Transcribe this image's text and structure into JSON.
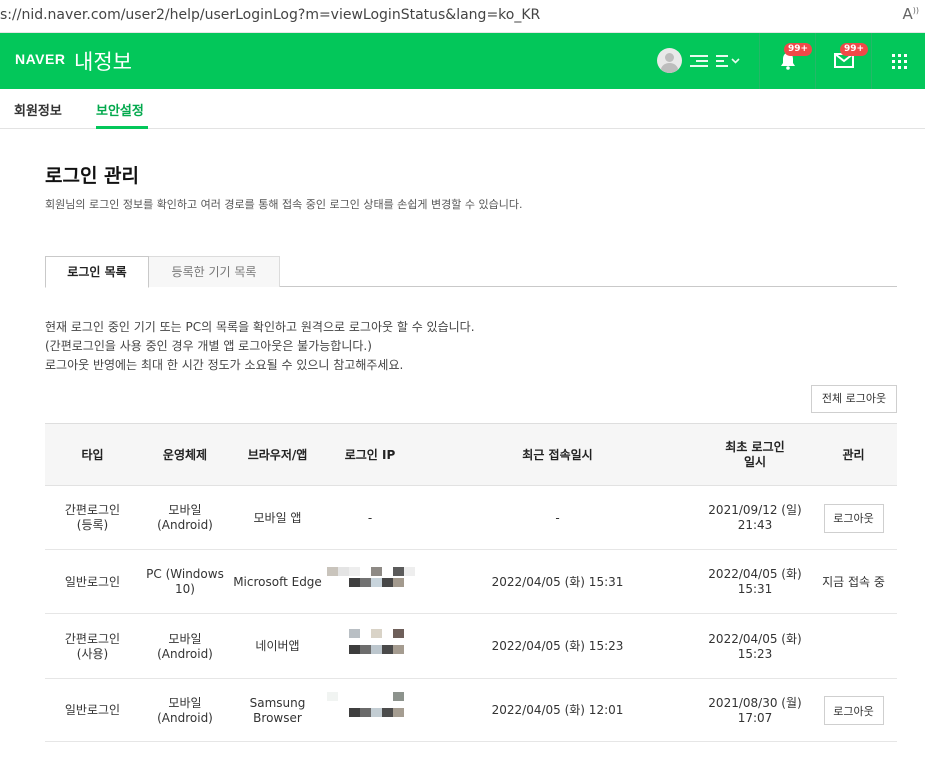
{
  "browser": {
    "url": "s://nid.naver.com/user2/help/userLoginLog?m=viewLoginStatus&lang=ko_KR",
    "reader_icon": "A"
  },
  "header": {
    "logo": "NAVER",
    "title": "내정보",
    "bell_badge": "99+",
    "mail_badge": "99+",
    "icons": [
      "avatar-icon",
      "user-menu-icon",
      "bell-icon",
      "mail-icon",
      "apps-grid-icon"
    ],
    "brand_color": "#03c75a"
  },
  "subnav": {
    "items": [
      "회원정보",
      "보안설정"
    ],
    "active": "보안설정"
  },
  "page": {
    "title": "로그인 관리",
    "description": "회원님의 로그인 정보를 확인하고 여러 경로를 통해 접속 중인 로그인 상태를 손쉽게 변경할 수 있습니다."
  },
  "tabs": [
    "로그인 목록",
    "등록한 기기 목록"
  ],
  "info_lines": [
    "현재 로그인 중인 기기 또는 PC의 목록을 확인하고 원격으로 로그아웃 할 수 있습니다.",
    "(간편로그인을 사용 중인 경우 개별 앱 로그아웃은 불가능합니다.)",
    "로그아웃 반영에는 최대 한 시간 정도가 소요될 수 있으니 참고해주세요."
  ],
  "logout_all_label": "전체 로그아웃",
  "table": {
    "headers": [
      "타입",
      "운영체제",
      "브라우저/앱",
      "로그인 IP",
      "최근 접속일시",
      "최초 로그인\n일시",
      "관리"
    ],
    "rows": [
      {
        "type": "간편로그인\n(등록)",
        "os": "모바일\n(Android)",
        "browser": "모바일 앱",
        "ip": "-",
        "recent": "-",
        "first": "2021/09/12 (일)\n21:43",
        "manage": "로그아웃",
        "manage_kind": "button"
      },
      {
        "type": "일반로그인",
        "os": "PC (Windows\n10)",
        "browser": "Microsoft Edge",
        "ip": "",
        "recent": "2022/04/05 (화) 15:31",
        "first": "2022/04/05 (화)\n15:31",
        "manage": "지금 접속 중",
        "manage_kind": "text"
      },
      {
        "type": "간편로그인\n(사용)",
        "os": "모바일\n(Android)",
        "browser": "네이버앱",
        "ip": "",
        "recent": "2022/04/05 (화) 15:23",
        "first": "2022/04/05 (화)\n15:23",
        "manage": "",
        "manage_kind": "none"
      },
      {
        "type": "일반로그인",
        "os": "모바일\n(Android)",
        "browser": "Samsung Browser",
        "ip": "",
        "recent": "2022/04/05 (화) 12:01",
        "first": "2021/08/30 (월)\n17:07",
        "manage": "로그아웃",
        "manage_kind": "button"
      }
    ]
  }
}
